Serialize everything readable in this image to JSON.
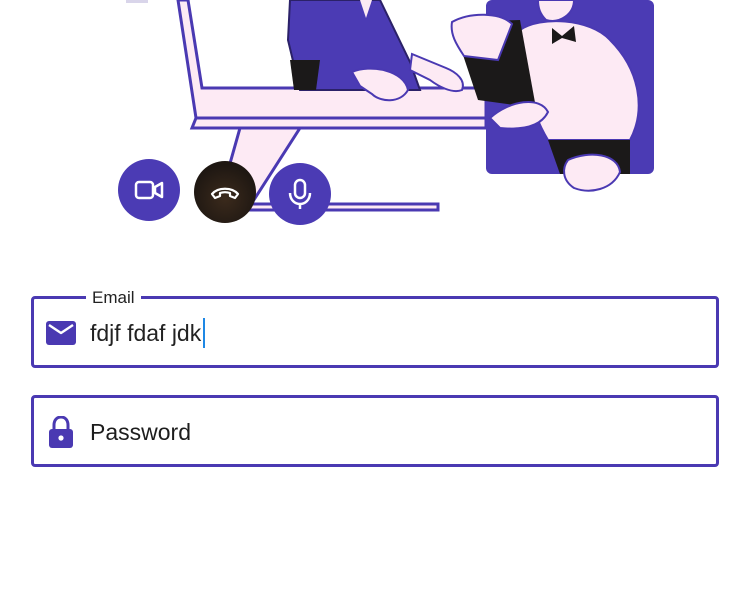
{
  "colors": {
    "primary": "#4a39b2",
    "illustration_pink": "#fdeaf4",
    "hangup": "#2a1f16",
    "caret": "#1e88e5"
  },
  "call_controls": {
    "video": {
      "icon": "video-camera-icon"
    },
    "hangup": {
      "icon": "phone-hangup-icon"
    },
    "mic": {
      "icon": "microphone-icon"
    }
  },
  "form": {
    "email": {
      "label": "Email",
      "value": "fdjf fdaf jdk",
      "icon": "mail-icon"
    },
    "password": {
      "placeholder": "Password",
      "value": "",
      "icon": "lock-icon"
    }
  }
}
